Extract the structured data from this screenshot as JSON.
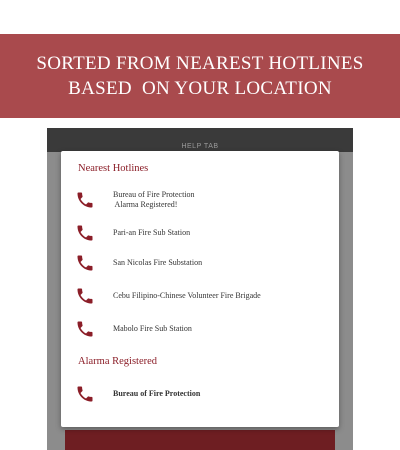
{
  "banner": {
    "line1": "SORTED FROM NEAREST HOTLINES",
    "line2": "BASED  ON YOUR LOCATION"
  },
  "app": {
    "tab_title": "HELP TAB"
  },
  "dialog": {
    "nearest_header": "Nearest Hotlines",
    "nearest_items": [
      {
        "label": "Bureau of Fire Protection\n Alarma Registered!",
        "icon": "phone-icon"
      },
      {
        "label": "Pari-an Fire Sub Station",
        "icon": "phone-icon"
      },
      {
        "label": "San Nicolas Fire Substation",
        "icon": "phone-icon"
      },
      {
        "label": "Cebu Filipino-Chinese Volunteer Fire Brigade",
        "icon": "phone-icon"
      },
      {
        "label": "Mabolo Fire Sub Station",
        "icon": "phone-icon"
      }
    ],
    "registered_header": "Alarma Registered",
    "registered_items": [
      {
        "label": "Bureau of Fire Protection",
        "icon": "phone-icon"
      }
    ]
  },
  "colors": {
    "banner_bg": "#a94a4d",
    "accent": "#8b1e28",
    "icon": "#8b1e28"
  }
}
